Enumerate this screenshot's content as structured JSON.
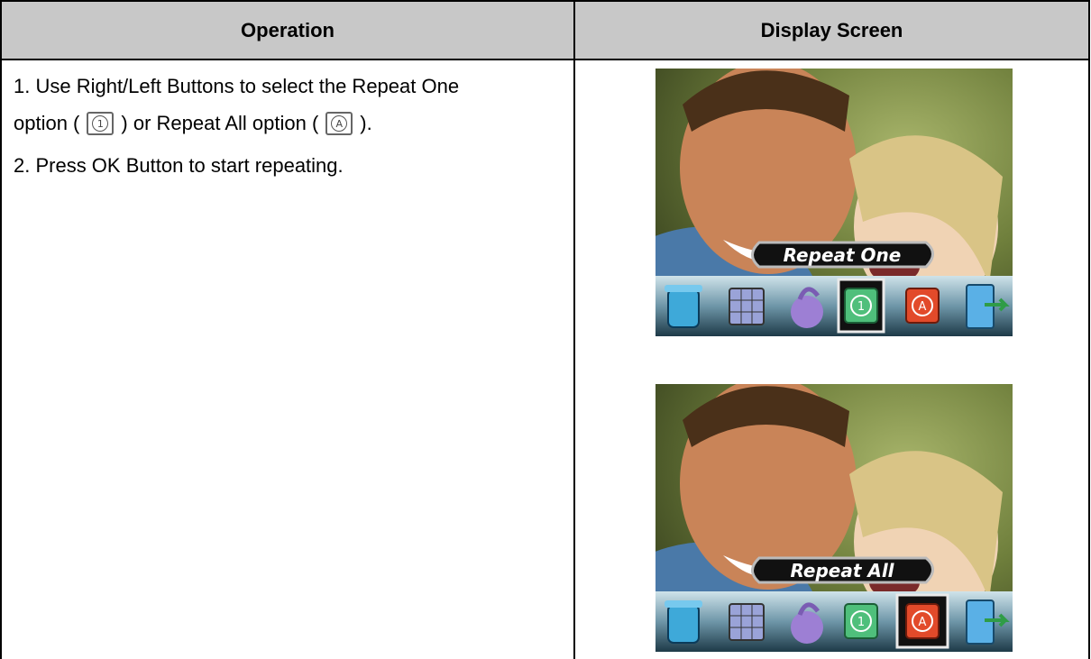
{
  "table": {
    "headers": {
      "operation": "Operation",
      "display": "Display Screen"
    }
  },
  "operation": {
    "step1_line1": "1. Use Right/Left Buttons to select the Repeat One",
    "step1_line2_a": "option (",
    "step1_line2_b": ") or Repeat All option (",
    "step1_line2_c": ").",
    "step2": "2. Press OK Button to start repeating.",
    "repeat_one_symbol": "1",
    "repeat_all_symbol": "A"
  },
  "screens": [
    {
      "label": "Repeat One",
      "selected": "repeat-one",
      "icons": [
        "trash-icon",
        "thumbnail-grid-icon",
        "lock-icon",
        "repeat-one-icon",
        "repeat-all-icon",
        "exit-icon"
      ]
    },
    {
      "label": "Repeat All",
      "selected": "repeat-all",
      "icons": [
        "trash-icon",
        "thumbnail-grid-icon",
        "lock-icon",
        "repeat-one-icon",
        "repeat-all-icon",
        "exit-icon"
      ]
    }
  ]
}
